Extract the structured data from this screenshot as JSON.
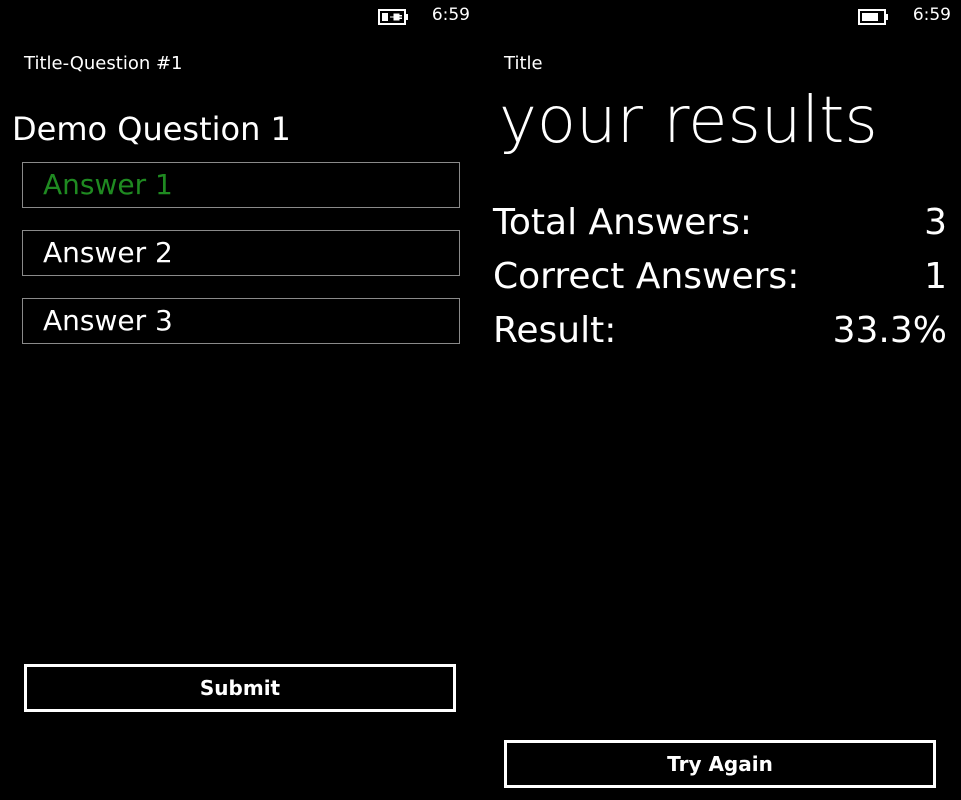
{
  "left_screen": {
    "status": {
      "time": "6:59",
      "battery_icon": "battery-charging-icon"
    },
    "app_title": "Title-Question #1",
    "question": "Demo Question 1",
    "answers": [
      "Answer 1",
      "Answer 2",
      "Answer 3"
    ],
    "selected_color": "#1f8a21",
    "submit_label": "Submit"
  },
  "right_screen": {
    "status": {
      "time": "6:59",
      "battery_icon": "battery-icon"
    },
    "app_title": "Title",
    "page_title": "your results",
    "results": [
      {
        "label": "Total Answers:",
        "value": "3"
      },
      {
        "label": "Correct Answers:",
        "value": "1"
      },
      {
        "label": "Result:",
        "value": "33.3%"
      }
    ],
    "try_again_label": "Try Again"
  }
}
